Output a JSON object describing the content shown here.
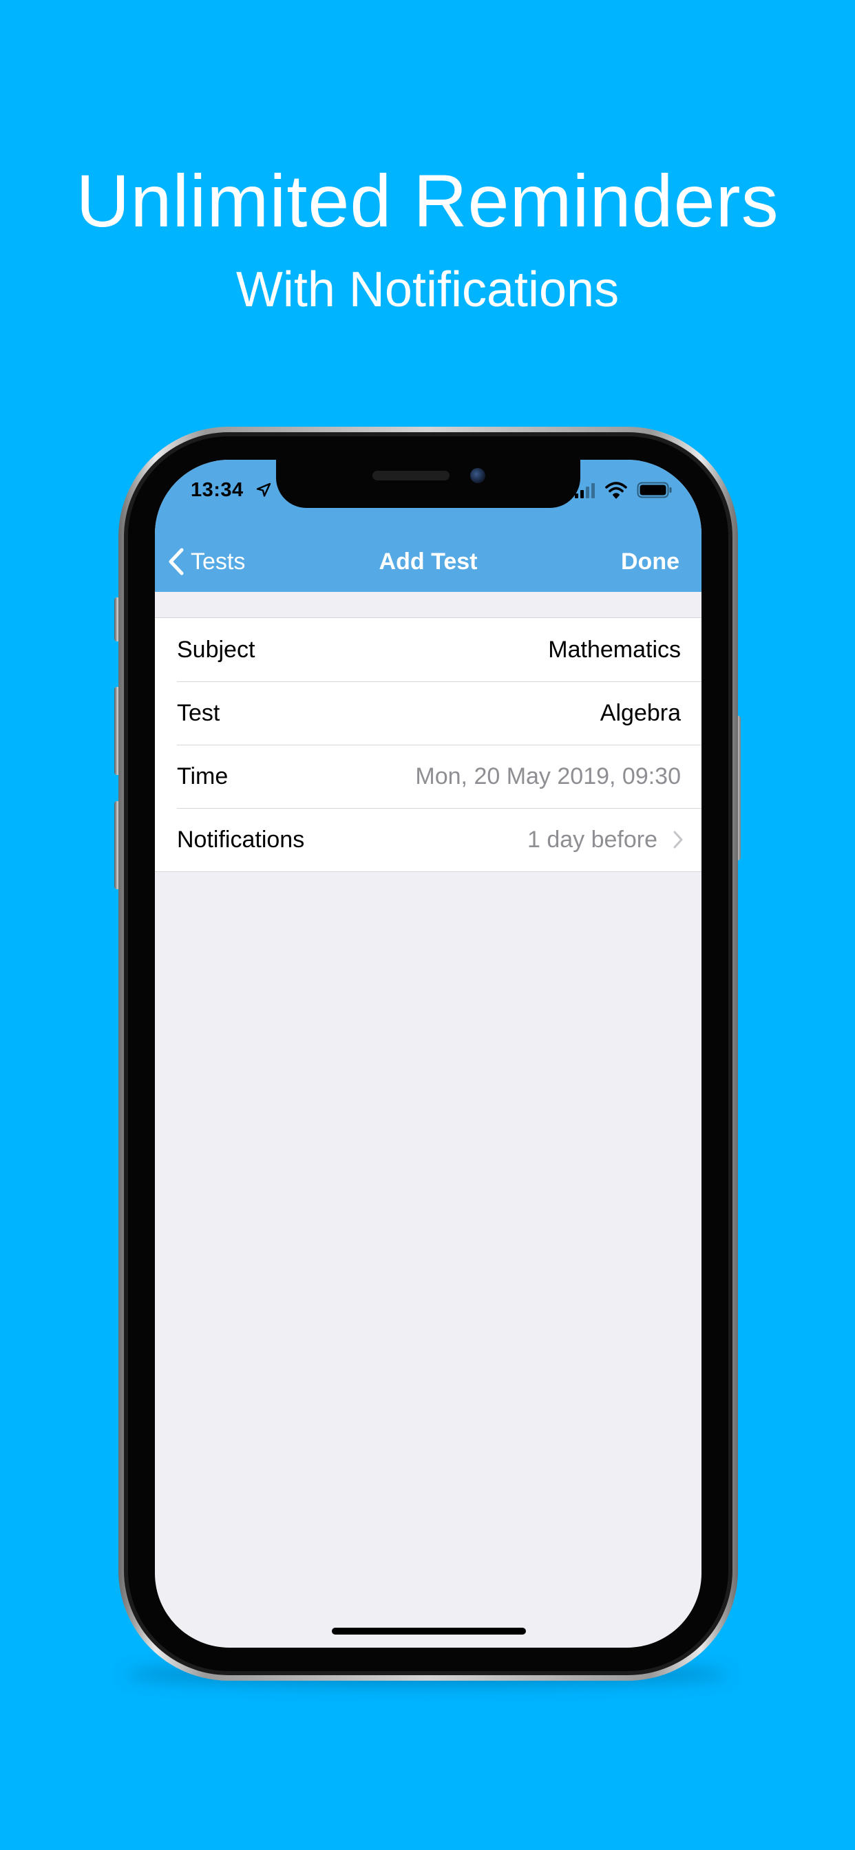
{
  "promo": {
    "title": "Unlimited Reminders",
    "subtitle": "With Notifications"
  },
  "status_bar": {
    "time": "13:34",
    "icons": [
      "location-arrow-icon",
      "cellular-signal-icon",
      "wifi-icon",
      "battery-icon"
    ]
  },
  "nav_bar": {
    "back_label": "Tests",
    "title": "Add Test",
    "done_label": "Done"
  },
  "form": {
    "rows": [
      {
        "label": "Subject",
        "value": "Mathematics"
      },
      {
        "label": "Test",
        "value": "Algebra"
      },
      {
        "label": "Time",
        "value": "Mon, 20 May 2019, 09:30"
      },
      {
        "label": "Notifications",
        "value": "1 day before"
      }
    ]
  },
  "colors": {
    "background": "#00b4ff",
    "nav_bar": "#55aae6",
    "table_background": "#efeff4",
    "muted_text": "#8e8e93"
  }
}
